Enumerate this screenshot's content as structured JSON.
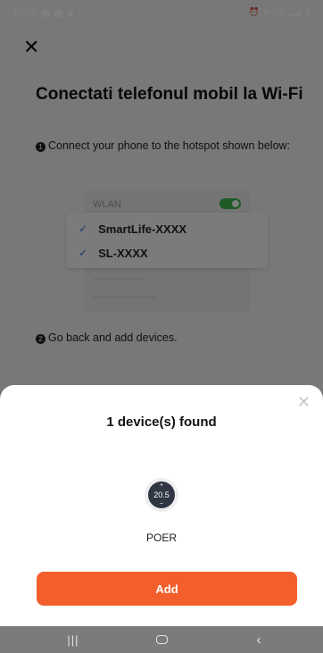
{
  "status_bar": {
    "time": "13:35",
    "left_icons": [
      "image-icon",
      "message-icon",
      "navigation-icon"
    ],
    "right_icons": [
      "alarm-icon",
      "wifi-icon",
      "signal-icon",
      "battery-icon"
    ],
    "network_label": "5G"
  },
  "background_page": {
    "title": "Conectati telefonul mobil la Wi-Fi",
    "step1_number": "1",
    "step1_text": "Connect your phone to the hotspot shown below:",
    "wlan_label": "WLAN",
    "ssids": [
      "SmartLife-XXXX",
      "SL-XXXX"
    ],
    "step2_number": "2",
    "step2_text": "Go back and add devices."
  },
  "sheet": {
    "found_text": "1 device(s) found",
    "device": {
      "name": "POER",
      "temperature": "20.5",
      "plus": "+",
      "minus": "–"
    },
    "add_label": "Add"
  },
  "colors": {
    "accent": "#f25f2d",
    "toggle_on": "#3bb54a",
    "check": "#4a7ad8"
  },
  "nav_bar": {
    "recent_glyph": "|||",
    "back_glyph": "‹"
  }
}
